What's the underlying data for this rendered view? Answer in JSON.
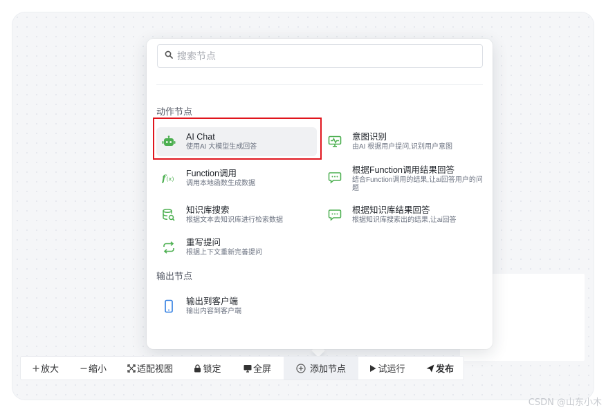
{
  "search": {
    "placeholder": "搜索节点"
  },
  "groups": {
    "action": "动作节点",
    "output": "输出节点"
  },
  "nodes": {
    "ai_chat": {
      "title": "AI Chat",
      "desc": "使用AI 大模型生成回答",
      "icon": "robot-icon"
    },
    "intent": {
      "title": "意图识别",
      "desc": "由AI 根据用户提问,识别用户意图",
      "icon": "monitor-icon"
    },
    "function": {
      "title": "Function调用",
      "desc": "调用本地函数生成数据",
      "icon": "function-icon"
    },
    "function_answer": {
      "title": "根据Function调用结果回答",
      "desc": "结合Function调用的结果,让ai回答用户的问题",
      "icon": "chat-bubble-icon"
    },
    "kb_search": {
      "title": "知识库搜索",
      "desc": "根据文本去知识库进行检索数据",
      "icon": "database-search-icon"
    },
    "kb_answer": {
      "title": "根据知识库结果回答",
      "desc": "根据知识库搜索出的结果,让ai回答",
      "icon": "chat-bubble-icon"
    },
    "rewrite": {
      "title": "重写提问",
      "desc": "根据上下文重新完善提问",
      "icon": "refresh-icon"
    },
    "output_client": {
      "title": "输出到客户端",
      "desc": "输出内容到客户端",
      "icon": "mobile-icon"
    }
  },
  "toolbar": {
    "zoom_in": "放大",
    "zoom_out": "缩小",
    "fit_view": "适配视图",
    "lock": "锁定",
    "fullscreen": "全屏",
    "add_node": "添加节点",
    "test_run": "试运行",
    "publish": "发布"
  },
  "watermark": "CSDN @山东小木",
  "colors": {
    "node_icon_green": "#4caf50",
    "output_icon_blue": "#2f7de1",
    "highlight_red": "#e0151d"
  }
}
